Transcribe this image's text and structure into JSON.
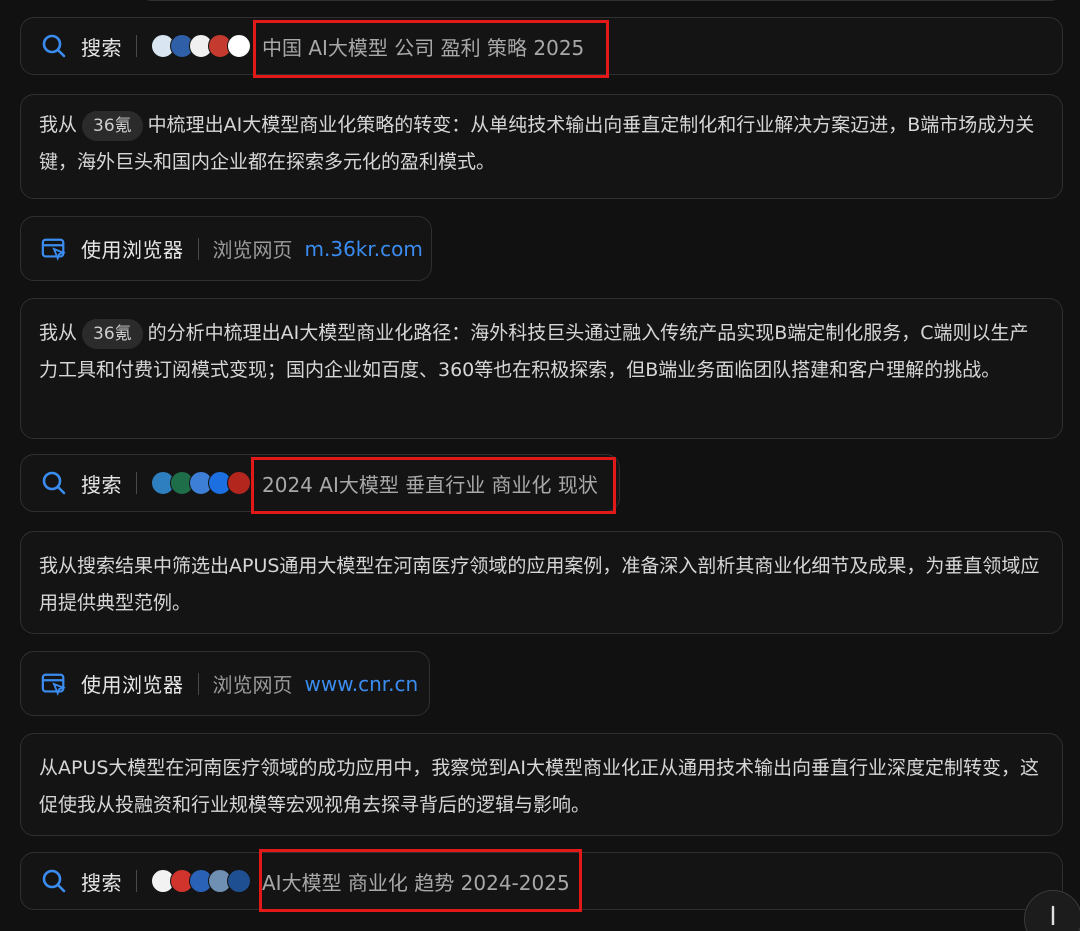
{
  "steps": [
    {
      "type": "search",
      "label": "搜索",
      "query": "中国 AI大模型 公司 盈利 策略 2025",
      "logos": [
        "#d9e6f2",
        "#2f5fa6",
        "#f0f0f0",
        "#c43a2e",
        "#ffffff"
      ]
    },
    {
      "type": "text",
      "before": "我从",
      "chip": "36氪",
      "after": "中梳理出AI大模型商业化策略的转变：从单纯技术输出向垂直定制化和行业解决方案迈进，B端市场成为关键，海外巨头和国内企业都在探索多元化的盈利模式。"
    },
    {
      "type": "browser",
      "label": "使用浏览器",
      "sub": "浏览网页",
      "url": "m.36kr.com"
    },
    {
      "type": "text",
      "before": "我从",
      "chip": "36氪",
      "after": "的分析中梳理出AI大模型商业化路径：海外科技巨头通过融入传统产品实现B端定制化服务，C端则以生产力工具和付费订阅模式变现；国内企业如百度、360等也在积极探索，但B端业务面临团队搭建和客户理解的挑战。"
    },
    {
      "type": "search",
      "label": "搜索",
      "query": "2024 AI大模型 垂直行业 商业化 现状",
      "logos": [
        "#2e7fbf",
        "#1f6e4a",
        "#3d7fd6",
        "#1b6fe0",
        "#b3261e"
      ]
    },
    {
      "type": "text",
      "before": "",
      "chip": "",
      "after": "我从搜索结果中筛选出APUS通用大模型在河南医疗领域的应用案例，准备深入剖析其商业化细节及成果，为垂直领域应用提供典型范例。"
    },
    {
      "type": "browser",
      "label": "使用浏览器",
      "sub": "浏览网页",
      "url": "www.cnr.cn"
    },
    {
      "type": "text",
      "before": "",
      "chip": "",
      "after": "从APUS大模型在河南医疗领域的成功应用中，我察觉到AI大模型商业化正从通用技术输出向垂直行业深度定制转变，这促使我从投融资和行业规模等宏观视角去探寻背后的逻辑与影响。"
    },
    {
      "type": "search",
      "label": "搜索",
      "query": "AI大模型 商业化 趋势 2024-2025",
      "logos": [
        "#f2f2f2",
        "#d0342c",
        "#2a62b8",
        "#6f8fb3",
        "#1d4f91"
      ]
    }
  ],
  "colors": {
    "accent": "#3b8cf0",
    "highlight": "#e11919"
  },
  "icons": {
    "search": "search-icon",
    "browser": "browser-icon",
    "scroll": "arrow-down-icon"
  }
}
